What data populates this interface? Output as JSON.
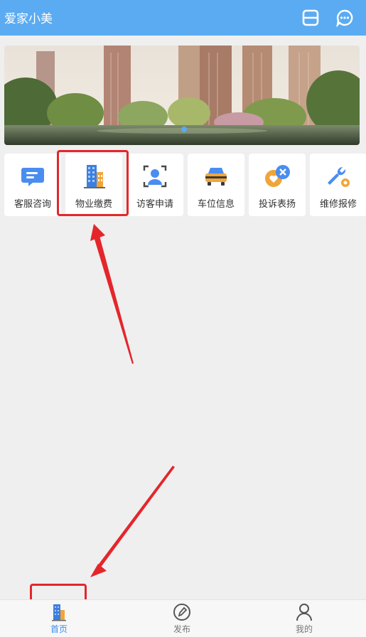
{
  "app": {
    "title": "爱家小美"
  },
  "header": {
    "scan_icon": "scan-icon",
    "chat_icon": "chat-bubble-icon"
  },
  "banner": {
    "indicator_count": 1,
    "active_index": 0
  },
  "services": [
    {
      "label": "客服咨询",
      "icon": "chat-icon"
    },
    {
      "label": "物业缴费",
      "icon": "building-icon"
    },
    {
      "label": "访客申请",
      "icon": "visitor-scan-icon"
    },
    {
      "label": "车位信息",
      "icon": "car-icon"
    },
    {
      "label": "投诉表扬",
      "icon": "heart-x-icon"
    },
    {
      "label": "维修报修",
      "icon": "wrench-icon"
    }
  ],
  "tabs": [
    {
      "label": "首页",
      "icon": "home-building-icon",
      "active": true
    },
    {
      "label": "发布",
      "icon": "publish-icon",
      "active": false
    },
    {
      "label": "我的",
      "icon": "profile-icon",
      "active": false
    }
  ],
  "colors": {
    "primary": "#5aabf2",
    "highlight": "#e4262b",
    "active_tab": "#3b8ef0"
  }
}
